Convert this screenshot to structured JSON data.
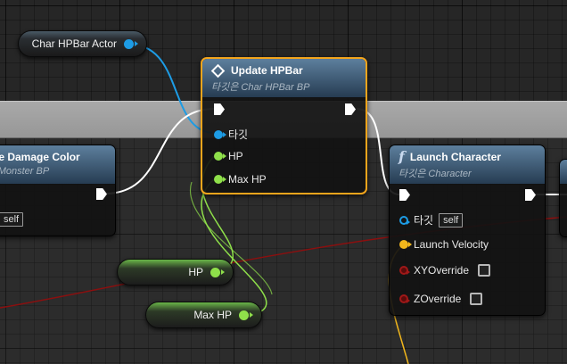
{
  "colors": {
    "exec_wire": "#ffffff",
    "object_wire": "#1d9ce5",
    "float_wire": "#8fe04a",
    "vector_wire": "#f1b61c",
    "bool_wire": "#8b0f0f",
    "selected_outline": "#f3a51c",
    "header": "#4f6f8d"
  },
  "variables": {
    "char_hpbar_actor": {
      "label": "Char HPBar Actor",
      "pin": "object"
    },
    "hp": {
      "label": "HP",
      "pin": "float"
    },
    "max_hp": {
      "label": "Max HP",
      "pin": "float"
    }
  },
  "nodes": {
    "change_damage_color": {
      "title": "ge Damage Color",
      "subtitle": "- Monster BP",
      "self_label": "self"
    },
    "update_hpbar": {
      "title": "Update HPBar",
      "subtitle": "타깃은 Char HPBar BP",
      "icon": "event-diamond-icon",
      "pins": {
        "target": "타깃",
        "hp": "HP",
        "max_hp": "Max HP"
      }
    },
    "launch_character": {
      "title": "Launch Character",
      "subtitle": "타깃은 Character",
      "icon": "function-icon",
      "pins": {
        "target": "타깃",
        "self_label": "self",
        "launch_velocity": "Launch Velocity",
        "xy_override": "XYOverride",
        "z_override": "ZOverride"
      }
    }
  }
}
